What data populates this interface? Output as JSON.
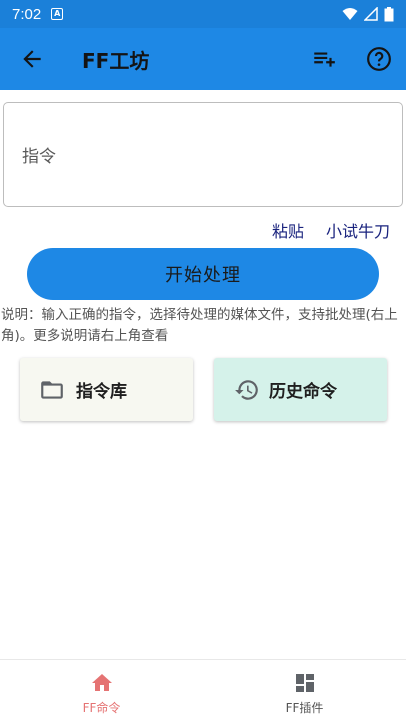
{
  "status": {
    "time": "7:02",
    "notif_letter": "A"
  },
  "appbar": {
    "title": "FF工坊"
  },
  "input": {
    "placeholder": "指令"
  },
  "links": {
    "paste": "粘贴",
    "trial": "小试牛刀"
  },
  "start_button": "开始处理",
  "description": "说明：输入正确的指令，选择待处理的媒体文件，支持批处理(右上角)。更多说明请右上角查看",
  "cards": {
    "library": "指令库",
    "history": "历史命令"
  },
  "bottom_nav": [
    {
      "label": "FF命令",
      "icon": "home-icon",
      "active": true
    },
    {
      "label": "FF插件",
      "icon": "dashboard-icon",
      "active": false
    }
  ],
  "colors": {
    "status_bar": "#1b80d9",
    "app_bar": "#1e88e5",
    "button": "#1e88e5",
    "link": "#1a237e",
    "active_nav": "#e57373",
    "card_library": "#f7f8f1",
    "card_history": "#d5f2ea"
  }
}
